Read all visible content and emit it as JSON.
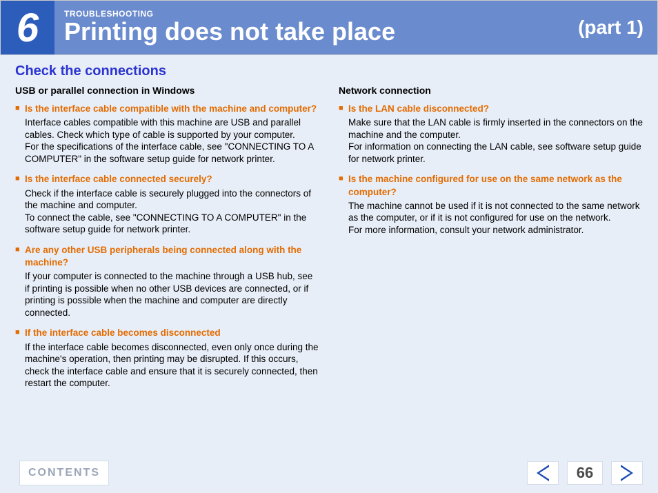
{
  "header": {
    "chapter_number": "6",
    "section_label": "TROUBLESHOOTING",
    "title": "Printing does not take place",
    "part": "(part 1)"
  },
  "main": {
    "heading": "Check the connections",
    "left": {
      "sub_heading": "USB or parallel connection in Windows",
      "items": [
        {
          "title": "Is the interface cable compatible with the machine and computer?",
          "body": "Interface cables compatible with this machine are USB and parallel cables. Check which type of cable is supported by your computer.\nFor the specifications of the interface cable, see \"CONNECTING TO A COMPUTER\" in the software setup guide for network printer."
        },
        {
          "title": "Is the interface cable connected securely?",
          "body": "Check if the interface cable is securely plugged into the connectors of the machine and computer.\nTo connect the cable, see \"CONNECTING TO A COMPUTER\" in the software setup guide for network printer."
        },
        {
          "title": "Are any other USB peripherals being connected along with the machine?",
          "body": "If your computer is connected to the machine through a USB hub, see if printing is possible when no other USB devices are connected, or if printing is possible when the machine and computer are directly connected."
        },
        {
          "title": "If the interface cable becomes disconnected",
          "body": "If the interface cable becomes disconnected, even only once during the machine's operation, then printing may be disrupted. If this occurs, check the interface cable and ensure that it is securely connected, then restart the computer."
        }
      ]
    },
    "right": {
      "sub_heading": "Network connection",
      "items": [
        {
          "title": "Is the LAN cable disconnected?",
          "body": "Make sure that the LAN cable is firmly inserted in the connectors on the machine and the computer.\nFor information on connecting the LAN cable, see software setup guide for network printer."
        },
        {
          "title": "Is the machine configured for use on the same network as the computer?",
          "body": "The machine cannot be used if it is not connected to the same network as the computer, or if it is not configured for use on the network.\nFor more information, consult your network administrator."
        }
      ]
    }
  },
  "footer": {
    "contents_label": "CONTENTS",
    "page_number": "66"
  }
}
